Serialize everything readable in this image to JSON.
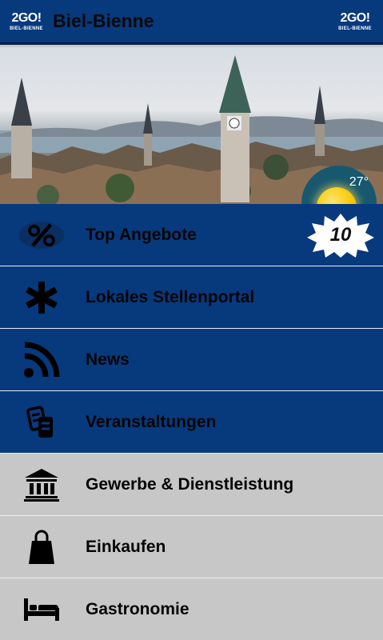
{
  "header": {
    "logo_main": "2GO!",
    "logo_sub": "BIEL-BIENNE",
    "title": "Biel-Bienne"
  },
  "weather": {
    "temperature": "27°",
    "icon": "sun-icon"
  },
  "menu": {
    "items": [
      {
        "label": "Top Angebote",
        "icon": "percent-icon",
        "style": "blue",
        "badge": "10"
      },
      {
        "label": "Lokales Stellenportal",
        "icon": "asterisk-icon",
        "style": "blue"
      },
      {
        "label": "News",
        "icon": "rss-icon",
        "style": "blue"
      },
      {
        "label": "Veranstaltungen",
        "icon": "tickets-icon",
        "style": "blue"
      },
      {
        "label": "Gewerbe & Dienstleistung",
        "icon": "bank-icon",
        "style": "gray"
      },
      {
        "label": "Einkaufen",
        "icon": "shopping-bag-icon",
        "style": "gray"
      },
      {
        "label": "Gastronomie",
        "icon": "bed-icon",
        "style": "gray"
      }
    ]
  },
  "colors": {
    "primary_blue": "#07397d",
    "item_gray": "#c7c7c7",
    "weather_circle": "#17586e",
    "sun_yellow": "#f7c800"
  }
}
